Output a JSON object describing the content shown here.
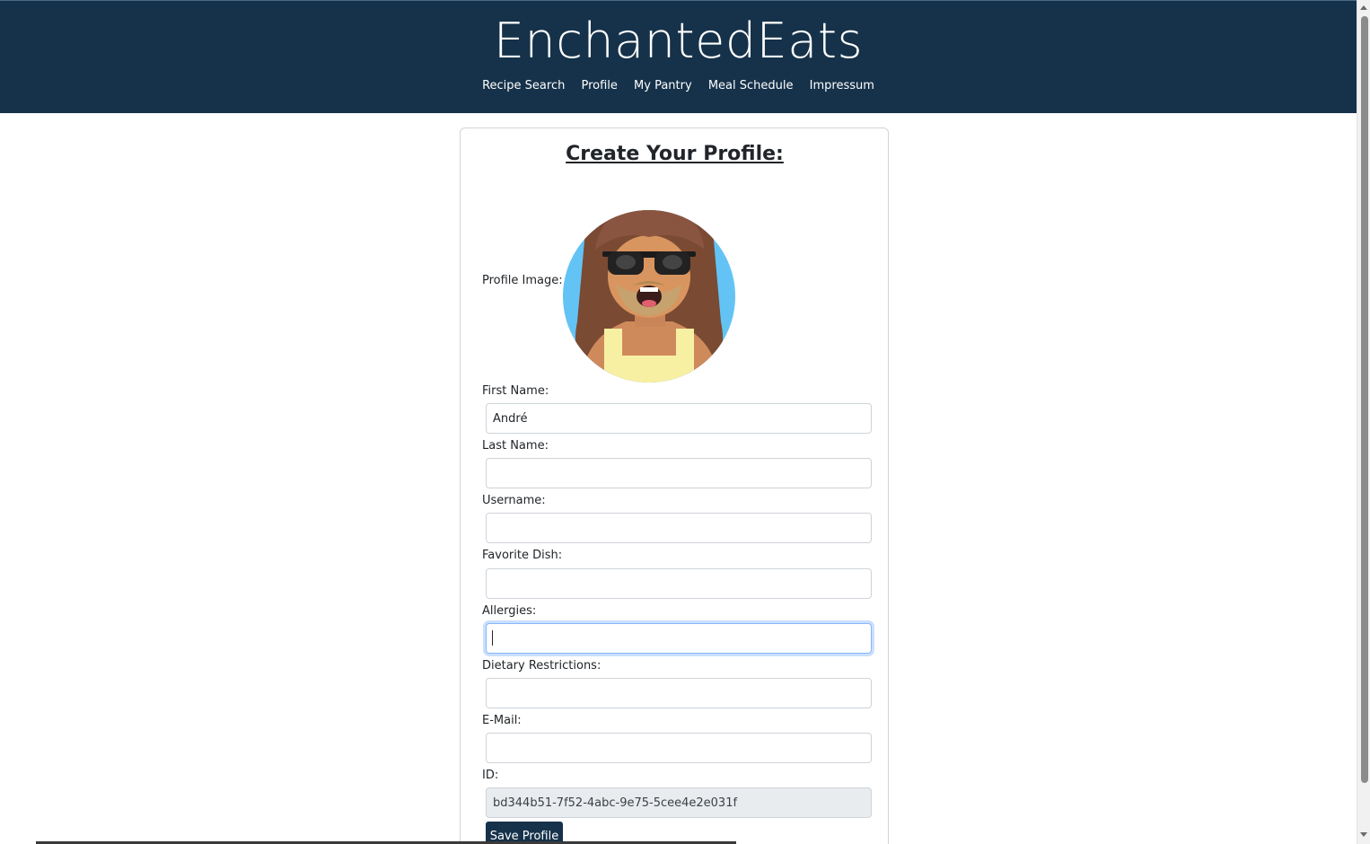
{
  "app": {
    "brand": "EnchantedEats"
  },
  "nav": {
    "items": [
      {
        "label": "Recipe Search"
      },
      {
        "label": "Profile"
      },
      {
        "label": "My Pantry"
      },
      {
        "label": "Meal Schedule"
      },
      {
        "label": "Impressum"
      }
    ]
  },
  "form": {
    "title": "Create Your Profile:",
    "profile_image_label": "Profile Image:",
    "avatar_icon": "avatar-illustration",
    "fields": {
      "first_name": {
        "label": "First Name:",
        "value": "André"
      },
      "last_name": {
        "label": "Last Name:",
        "value": ""
      },
      "username": {
        "label": "Username:",
        "value": ""
      },
      "favorite_dish": {
        "label": "Favorite Dish:",
        "value": ""
      },
      "allergies": {
        "label": "Allergies:",
        "value": ""
      },
      "dietary_restrictions": {
        "label": "Dietary Restrictions:",
        "value": ""
      },
      "email": {
        "label": "E-Mail:",
        "value": ""
      },
      "id": {
        "label": "ID:",
        "value": "bd344b51-7f52-4abc-9e75-5cee4e2e031f"
      }
    },
    "save_label": "Save Profile"
  },
  "colors": {
    "header_bg": "#16324a",
    "button_bg": "#16324a",
    "focus_ring": "#86b7fe"
  }
}
